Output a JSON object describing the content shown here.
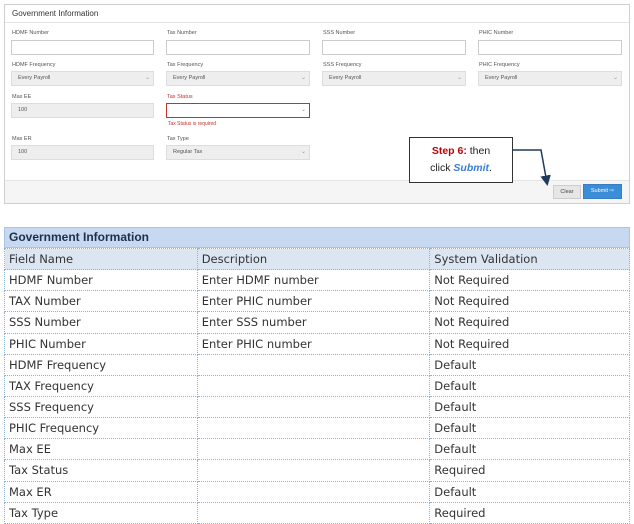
{
  "panel": {
    "title": "Government Information",
    "fields": {
      "hdmf_number": {
        "label": "HDMF Number",
        "value": ""
      },
      "tax_number": {
        "label": "Tax Number",
        "value": ""
      },
      "sss_number": {
        "label": "SSS Number",
        "value": ""
      },
      "phic_number": {
        "label": "PHIC Number",
        "value": ""
      },
      "hdmf_frequency": {
        "label": "HDMF Frequency",
        "value": "Every Payroll"
      },
      "tax_frequency": {
        "label": "Tax Frequency",
        "value": "Every Payroll"
      },
      "sss_frequency": {
        "label": "SSS Frequency",
        "value": "Every Payroll"
      },
      "phic_frequency": {
        "label": "PHIC Frequency",
        "value": "Every Payroll"
      },
      "max_ee": {
        "label": "Max EE",
        "value": "100"
      },
      "tax_status": {
        "label": "Tax Status",
        "value": "",
        "error": "Tax Status is required"
      },
      "max_er": {
        "label": "Max ER",
        "value": "100"
      },
      "tax_type": {
        "label": "Tax Type",
        "value": "Regular Tax"
      }
    },
    "buttons": {
      "clear": "Clear",
      "submit": "Submit ⇨"
    }
  },
  "callout": {
    "step": "Step 6:",
    "then": " then",
    "click": "click ",
    "submit": "Submit",
    "period": "."
  },
  "table": {
    "title": "Government Information",
    "headers": [
      "Field Name",
      "Description",
      "System Validation"
    ],
    "rows": [
      [
        "HDMF Number",
        "Enter HDMF number",
        "Not Required"
      ],
      [
        "TAX Number",
        "Enter PHIC number",
        "Not Required"
      ],
      [
        "SSS Number",
        "Enter SSS number",
        "Not Required"
      ],
      [
        "PHIC Number",
        "Enter PHIC number",
        "Not Required"
      ],
      [
        "HDMF Frequency",
        "",
        "Default"
      ],
      [
        "TAX Frequency",
        "",
        "Default"
      ],
      [
        "SSS Frequency",
        "",
        "Default"
      ],
      [
        "PHIC Frequency",
        "",
        "Default"
      ],
      [
        "Max EE",
        "",
        "Default"
      ],
      [
        "Tax Status",
        "",
        "Required"
      ],
      [
        "Max ER",
        "",
        "Default"
      ],
      [
        "Tax Type",
        "",
        "Required"
      ]
    ]
  },
  "colors": {
    "error": "#c9302c",
    "submit_button": "#3c8dd8",
    "table_header": "#c6d9f1",
    "callout_step": "#c00000",
    "callout_submit": "#3b7dd8"
  }
}
